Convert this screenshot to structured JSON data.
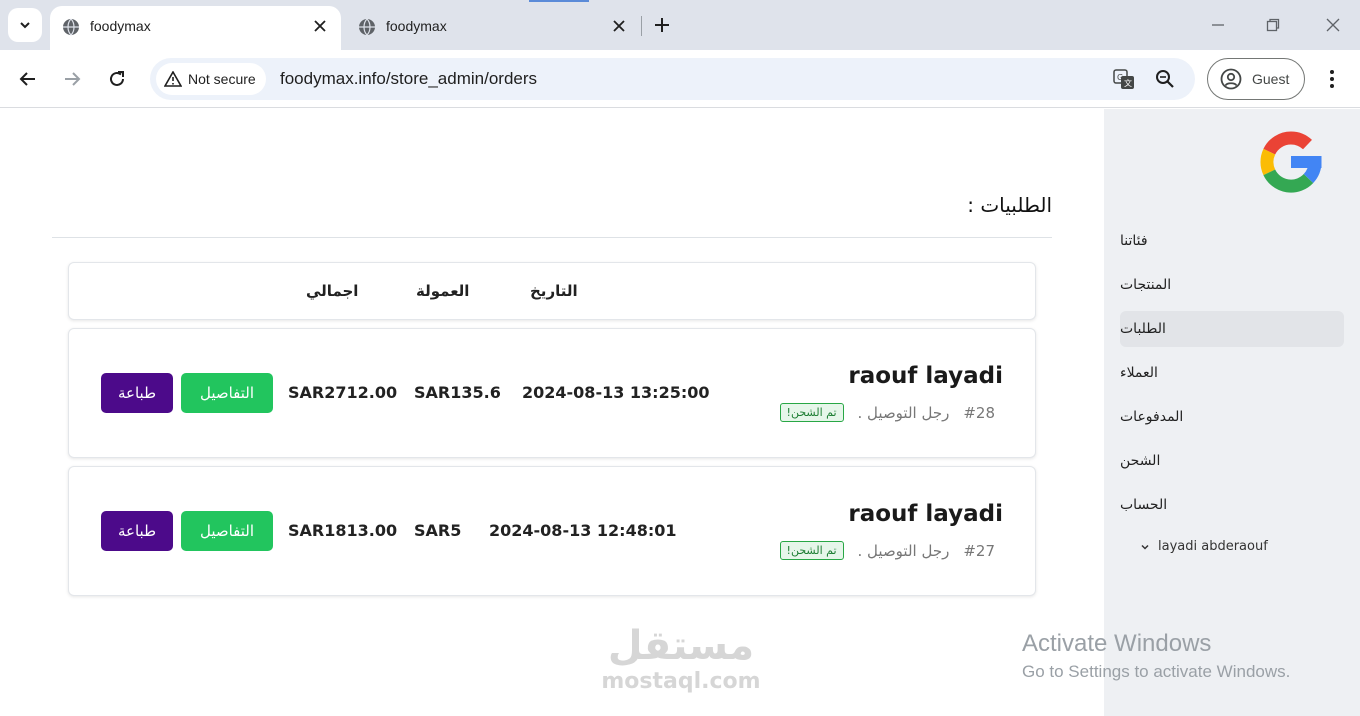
{
  "browser": {
    "tabs": [
      {
        "title": "foodymax",
        "active": true
      },
      {
        "title": "foodymax",
        "active": false
      }
    ],
    "security_label": "Not secure",
    "url": "foodymax.info/store_admin/orders",
    "profile_label": "Guest"
  },
  "sidebar": {
    "items": [
      {
        "label": "فئاتنا"
      },
      {
        "label": "المنتجات"
      },
      {
        "label": "الطلبات",
        "active": true
      },
      {
        "label": "العملاء"
      },
      {
        "label": "المدفوعات"
      },
      {
        "label": "الشحن"
      },
      {
        "label": "الحساب"
      }
    ],
    "user": "layadi abderaouf"
  },
  "page": {
    "title": "الطلبيات :"
  },
  "table": {
    "headers": {
      "date": "التاريخ",
      "commission": "العمولة",
      "total": "اجمالي"
    }
  },
  "orders": [
    {
      "customer": "raouf layadi",
      "order_no": "#28",
      "delivery": "رجل التوصيل .",
      "status": "تم الشحن!",
      "date": "2024-08-13 13:25:00",
      "commission": "SAR135.6",
      "total": "SAR2712.00",
      "details_label": "التفاصيل",
      "print_label": "طباعة"
    },
    {
      "customer": "raouf layadi",
      "order_no": "#27",
      "delivery": "رجل التوصيل .",
      "status": "تم الشحن!",
      "date": "2024-08-13 12:48:01",
      "commission": "SAR5",
      "total": "SAR1813.00",
      "details_label": "التفاصيل",
      "print_label": "طباعة"
    }
  ],
  "os_overlay": {
    "line1": "Activate Windows",
    "line2": "Go to Settings to activate Windows."
  },
  "watermark": {
    "arabic": "مستقل",
    "latin": "mostaql.com"
  },
  "colors": {
    "details_button": "#22c55e",
    "print_button": "#4c0a8a",
    "status_badge": "#28a745",
    "sidebar_bg": "#eef0f3"
  }
}
